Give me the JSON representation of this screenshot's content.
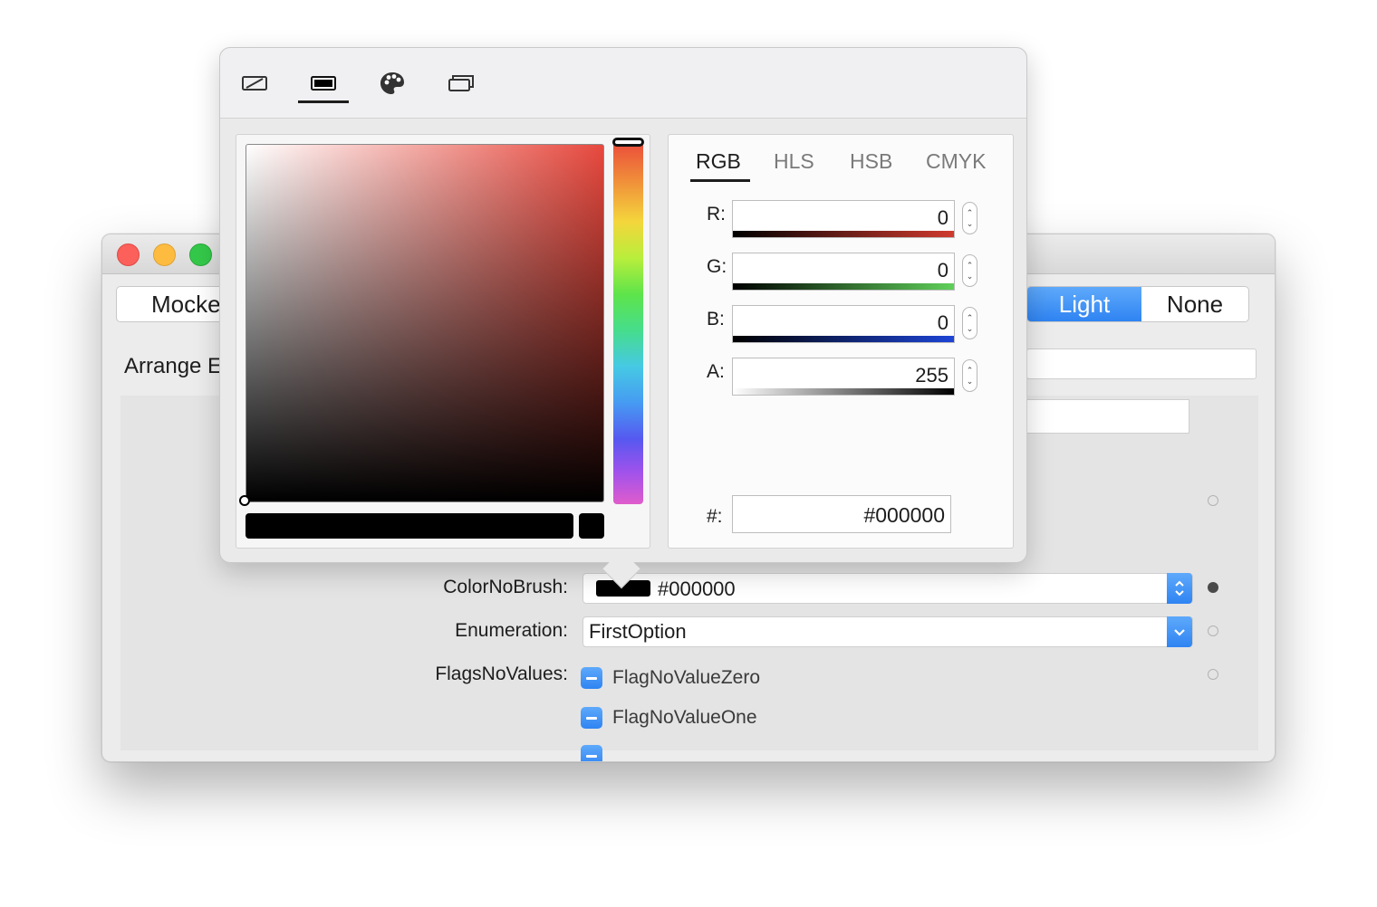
{
  "window": {
    "segment_left": "Mocke",
    "segment_right": {
      "light": "Light",
      "none": "None"
    },
    "arrange_label": "Arrange E"
  },
  "properties": {
    "color_no_brush": {
      "label": "ColorNoBrush:",
      "value": "#000000",
      "swatch_color": "#000000"
    },
    "enumeration": {
      "label": "Enumeration:",
      "value": "FirstOption"
    },
    "flags_no_values": {
      "label": "FlagsNoValues:",
      "flags": [
        "FlagNoValueZero",
        "FlagNoValueOne"
      ]
    }
  },
  "color_picker": {
    "mode_icons": [
      "no-color-icon",
      "solid-color-icon",
      "palette-icon",
      "resources-icon"
    ],
    "selected_mode": "solid-color-icon",
    "tabs": [
      "RGB",
      "HLS",
      "HSB",
      "CMYK"
    ],
    "active_tab": "RGB",
    "components": [
      {
        "label": "R:",
        "value": "0"
      },
      {
        "label": "G:",
        "value": "0"
      },
      {
        "label": "B:",
        "value": "0"
      },
      {
        "label": "A:",
        "value": "255"
      }
    ],
    "hex_label": "#:",
    "hex_value": "#000000",
    "hue_base_color": "#e8493e"
  },
  "colors": {
    "accent": "#2f84f2",
    "traffic_red": "#fc605b",
    "traffic_yellow": "#fdbc40",
    "traffic_green": "#34c84a"
  }
}
